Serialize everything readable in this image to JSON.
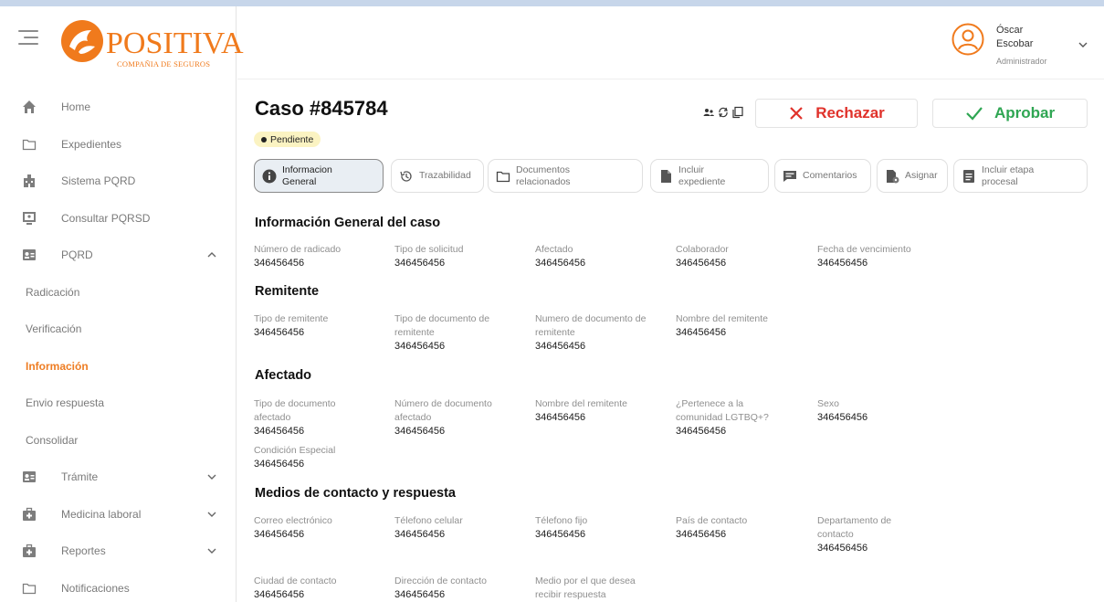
{
  "brand": {
    "name": "POSITIVA",
    "subtitle": "COMPAÑIA DE SEGUROS",
    "color": "#F07A1C"
  },
  "sidebar": {
    "items": [
      {
        "label": "Home",
        "icon": "home-icon"
      },
      {
        "label": "Expedientes",
        "icon": "folder-icon"
      },
      {
        "label": "Sistema PQRD",
        "icon": "building-icon"
      },
      {
        "label": "Consultar PQRSD",
        "icon": "monitor-icon"
      },
      {
        "label": "PQRD",
        "icon": "contact-card-icon",
        "expanded": true
      },
      {
        "label": "Radicación",
        "sub": true
      },
      {
        "label": "Verificación",
        "sub": true
      },
      {
        "label": "Información",
        "sub": true,
        "active": true
      },
      {
        "label": "Envio respuesta",
        "sub": true
      },
      {
        "label": "Consolidar",
        "sub": true
      },
      {
        "label": "Trámite",
        "icon": "contact-card-icon"
      },
      {
        "label": "Medicina laboral",
        "icon": "medical-kit-icon"
      },
      {
        "label": "Reportes",
        "icon": "medical-kit-icon"
      },
      {
        "label": "Notificaciones",
        "icon": "folder-icon"
      }
    ]
  },
  "user": {
    "first_name": "Óscar",
    "last_name": "Escobar",
    "role": "Administrador"
  },
  "case": {
    "title": "Caso #845784",
    "status": "Pendiente",
    "reject_label": "Rechazar",
    "approve_label": "Aprobar"
  },
  "tabs": [
    {
      "label": "Informacion General",
      "active": true
    },
    {
      "label": "Trazabilidad"
    },
    {
      "label": "Documentos relacionados"
    },
    {
      "label": "Incluir expediente"
    },
    {
      "label": "Comentarios"
    },
    {
      "label": "Asignar"
    },
    {
      "label": "Incluir etapa procesal"
    }
  ],
  "sections": {
    "general": {
      "title": "Información General del caso",
      "fields": [
        {
          "label": "Número de radicado",
          "value": "346456456"
        },
        {
          "label": "Tipo de solicitud",
          "value": "346456456"
        },
        {
          "label": "Afectado",
          "value": "346456456"
        },
        {
          "label": "Colaborador",
          "value": "346456456"
        },
        {
          "label": "Fecha de vencimiento",
          "value": "346456456"
        }
      ]
    },
    "remitente": {
      "title": "Remitente",
      "fields": [
        {
          "label": "Tipo de remitente",
          "value": "346456456"
        },
        {
          "label": "Tipo de documento de remitente",
          "value": "346456456"
        },
        {
          "label": "Numero de documento de remitente",
          "value": "346456456"
        },
        {
          "label": "Nombre del remitente",
          "value": "346456456"
        }
      ]
    },
    "afectado": {
      "title": "Afectado",
      "fields": [
        {
          "label": "Tipo de documento afectado",
          "value": "346456456"
        },
        {
          "label": "Número de documento afectado",
          "value": "346456456"
        },
        {
          "label": "Nombre del remitente",
          "value": "346456456"
        },
        {
          "label": "¿Pertenece a la comunidad LGTBQ+?",
          "value": "346456456"
        },
        {
          "label": "Sexo",
          "value": "346456456"
        },
        {
          "label": "Condición Especial",
          "value": "346456456"
        }
      ]
    },
    "contacto": {
      "title": "Medios de contacto y respuesta",
      "fields": [
        {
          "label": "Correo electrónico",
          "value": "346456456"
        },
        {
          "label": "Télefono celular",
          "value": "346456456"
        },
        {
          "label": "Télefono fijo",
          "value": "346456456"
        },
        {
          "label": "País de contacto",
          "value": "346456456"
        },
        {
          "label": "Departamento de contacto",
          "value": "346456456"
        },
        {
          "label": "Ciudad de contacto",
          "value": "346456456"
        },
        {
          "label": "Dirección de contacto",
          "value": "346456456"
        },
        {
          "label": "Medio por el que desea recibir respuesta",
          "value": ""
        }
      ]
    }
  },
  "colors": {
    "accent": "#EE7D23",
    "reject": "#E0322B",
    "approve": "#2FA653",
    "badge": "#FBF3C2"
  }
}
